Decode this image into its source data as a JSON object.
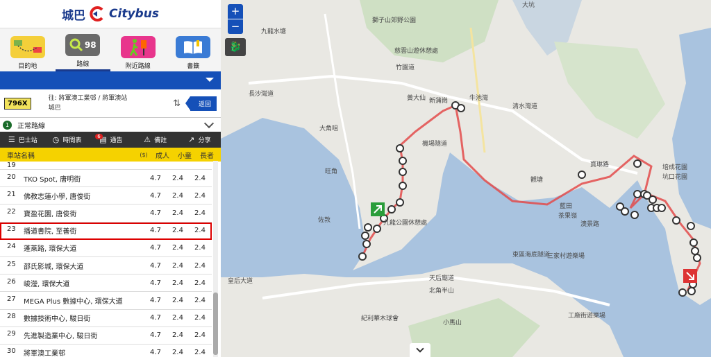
{
  "brand": {
    "cn": "城巴",
    "en": "Citybus"
  },
  "nav": [
    {
      "label": "目的地",
      "icon": "destination-icon"
    },
    {
      "label": "路線",
      "icon": "route-search-icon",
      "badge": "98"
    },
    {
      "label": "附近路線",
      "icon": "nearby-walk-icon"
    },
    {
      "label": "書籤",
      "icon": "bookmark-book-icon"
    }
  ],
  "route": {
    "number": "796X",
    "direction": "往: 將軍澳工業邨 / 將軍澳站",
    "operator": "城巴",
    "back": "返回"
  },
  "route_type": {
    "num": "1",
    "label": "正常路線"
  },
  "toolbar": {
    "stops": "巴士站",
    "timetable": "時間表",
    "notice": "通告",
    "notice_count": "6",
    "remarks": "備註",
    "share": "分享"
  },
  "table": {
    "headers": {
      "name": "車站名稱",
      "currency": "($)",
      "adult": "成人",
      "child": "小童",
      "elderly": "長者"
    },
    "rows": [
      {
        "seq": "19",
        "name": "",
        "adult": "",
        "child": "",
        "elderly": ""
      },
      {
        "seq": "20",
        "name": "TKO Spot, 唐明街",
        "adult": "4.7",
        "child": "2.4",
        "elderly": "2.4"
      },
      {
        "seq": "21",
        "name": "佛教志蓮小學, 唐俊街",
        "adult": "4.7",
        "child": "2.4",
        "elderly": "2.4"
      },
      {
        "seq": "22",
        "name": "寶盈花園, 唐俊街",
        "adult": "4.7",
        "child": "2.4",
        "elderly": "2.4"
      },
      {
        "seq": "23",
        "name": "播道書院, 至善街",
        "adult": "4.7",
        "child": "2.4",
        "elderly": "2.4",
        "highlight": true
      },
      {
        "seq": "24",
        "name": "蓬萊路, 環保大道",
        "adult": "4.7",
        "child": "2.4",
        "elderly": "2.4"
      },
      {
        "seq": "25",
        "name": "邵氏影城, 環保大道",
        "adult": "4.7",
        "child": "2.4",
        "elderly": "2.4"
      },
      {
        "seq": "26",
        "name": "峻瀅, 環保大道",
        "adult": "4.7",
        "child": "2.4",
        "elderly": "2.4"
      },
      {
        "seq": "27",
        "name": "MEGA Plus 數據中心, 環保大道",
        "adult": "4.7",
        "child": "2.4",
        "elderly": "2.4"
      },
      {
        "seq": "28",
        "name": "數據技術中心, 駿日街",
        "adult": "4.7",
        "child": "2.4",
        "elderly": "2.4"
      },
      {
        "seq": "29",
        "name": "先進製造業中心, 駿日街",
        "adult": "4.7",
        "child": "2.4",
        "elderly": "2.4"
      },
      {
        "seq": "30",
        "name": "將軍澳工業邨",
        "adult": "4.7",
        "child": "2.4",
        "elderly": "2.4"
      }
    ]
  },
  "map": {
    "zoom_in": "+",
    "zoom_out": "−",
    "labels": [
      {
        "t": "九龍水塘"
      },
      {
        "t": "獅子山郊野公園"
      },
      {
        "t": "慈雲山遊休憩處"
      },
      {
        "t": "竹園道"
      },
      {
        "t": "黃大仙"
      },
      {
        "t": "新蒲崗"
      },
      {
        "t": "牛池灣"
      },
      {
        "t": "清水灣道"
      },
      {
        "t": "寶琳路"
      },
      {
        "t": "培成花園"
      },
      {
        "t": "坑口花園"
      },
      {
        "t": "大角咀"
      },
      {
        "t": "長沙灣道"
      },
      {
        "t": "旺角"
      },
      {
        "t": "機場隧道"
      },
      {
        "t": "觀塘"
      },
      {
        "t": "藍田"
      },
      {
        "t": "茶果嶺"
      },
      {
        "t": "東區海底隧道"
      },
      {
        "t": "三家村遊樂場"
      },
      {
        "t": "澳景路"
      },
      {
        "t": "皇后大道"
      },
      {
        "t": "北角半山"
      },
      {
        "t": "天后廟道"
      },
      {
        "t": "紀利華木球會"
      },
      {
        "t": "小馬山"
      },
      {
        "t": "工廠街遊樂場"
      },
      {
        "t": "佐敦"
      },
      {
        "t": "九龍公園休憩處"
      },
      {
        "t": "大坑"
      }
    ]
  },
  "colors": {
    "accent": "#1550b8",
    "highlight": "#d00000",
    "route": "#e34b4b",
    "header": "#f5d200"
  }
}
